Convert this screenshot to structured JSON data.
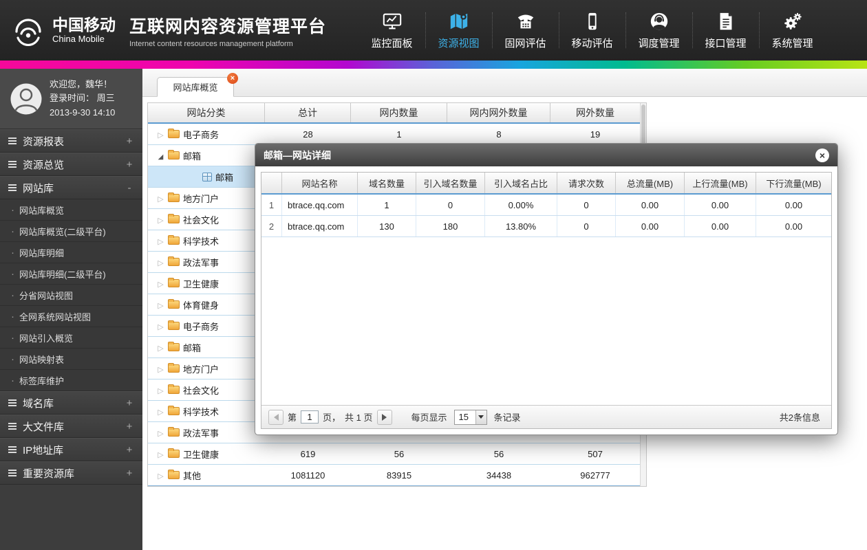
{
  "icons": {
    "close_x": "×"
  },
  "header": {
    "logo_cn": "中国移动",
    "logo_en": "China Mobile",
    "title_cn": "互联网内容资源管理平台",
    "title_en": "Internet content resources management platform",
    "nav": [
      {
        "label": "监控面板"
      },
      {
        "label": "资源视图"
      },
      {
        "label": "固网评估"
      },
      {
        "label": "移动评估"
      },
      {
        "label": "调度管理"
      },
      {
        "label": "接口管理"
      },
      {
        "label": "系统管理"
      }
    ]
  },
  "sidebar": {
    "user": {
      "welcome": "欢迎您，魏华！",
      "login_label": "登录时间： 周三",
      "login_time": "2013-9-30  14:10"
    },
    "items": [
      {
        "type": "top",
        "label": "资源报表",
        "toggle": "+"
      },
      {
        "type": "top",
        "label": "资源总览",
        "toggle": "+"
      },
      {
        "type": "top",
        "label": "网站库",
        "toggle": "-"
      },
      {
        "type": "sub",
        "label": "网站库概览"
      },
      {
        "type": "sub",
        "label": "网站库概览(二级平台)"
      },
      {
        "type": "sub",
        "label": "网站库明细"
      },
      {
        "type": "sub",
        "label": "网站库明细(二级平台)"
      },
      {
        "type": "sub",
        "label": "分省网站视图"
      },
      {
        "type": "sub",
        "label": "全网系统网站视图"
      },
      {
        "type": "sub",
        "label": "网站引入概览"
      },
      {
        "type": "sub",
        "label": "网站映射表"
      },
      {
        "type": "sub",
        "label": "标签库维护"
      },
      {
        "type": "top",
        "label": "域名库",
        "toggle": "+"
      },
      {
        "type": "top",
        "label": "大文件库",
        "toggle": "+"
      },
      {
        "type": "top",
        "label": "IP地址库",
        "toggle": "+"
      },
      {
        "type": "top",
        "label": "重要资源库",
        "toggle": "+"
      }
    ]
  },
  "main": {
    "tab_label": "网站库概览",
    "table": {
      "headers": [
        "网站分类",
        "总计",
        "网内数量",
        "网内网外数量",
        "网外数量"
      ],
      "rows": [
        {
          "level": 1,
          "marker": "collapsed",
          "label": "电子商务",
          "values": [
            "28",
            "1",
            "8",
            "19"
          ]
        },
        {
          "level": 1,
          "marker": "expanded",
          "label": "邮箱",
          "values": [
            "",
            "",
            "",
            ""
          ]
        },
        {
          "level": 2,
          "marker": "none",
          "label": "邮箱",
          "selected": true,
          "values": [
            "",
            "",
            "",
            ""
          ]
        },
        {
          "level": 1,
          "marker": "collapsed",
          "label": "地方门户",
          "values": [
            "",
            "",
            "",
            ""
          ]
        },
        {
          "level": 1,
          "marker": "collapsed",
          "label": "社会文化",
          "values": [
            "",
            "",
            "",
            ""
          ]
        },
        {
          "level": 1,
          "marker": "collapsed",
          "label": "科学技术",
          "values": [
            "",
            "",
            "",
            ""
          ]
        },
        {
          "level": 1,
          "marker": "collapsed",
          "label": "政法军事",
          "values": [
            "",
            "",
            "",
            ""
          ]
        },
        {
          "level": 1,
          "marker": "collapsed",
          "label": "卫生健康",
          "values": [
            "",
            "",
            "",
            ""
          ]
        },
        {
          "level": 1,
          "marker": "collapsed",
          "label": "体育健身",
          "values": [
            "",
            "",
            "",
            ""
          ]
        },
        {
          "level": 1,
          "marker": "collapsed",
          "label": "电子商务",
          "values": [
            "",
            "",
            "",
            ""
          ]
        },
        {
          "level": 1,
          "marker": "collapsed",
          "label": "邮箱",
          "values": [
            "",
            "",
            "",
            ""
          ]
        },
        {
          "level": 1,
          "marker": "collapsed",
          "label": "地方门户",
          "values": [
            "",
            "",
            "",
            ""
          ]
        },
        {
          "level": 1,
          "marker": "collapsed",
          "label": "社会文化",
          "values": [
            "",
            "",
            "",
            ""
          ]
        },
        {
          "level": 1,
          "marker": "collapsed",
          "label": "科学技术",
          "values": [
            "",
            "",
            "",
            ""
          ]
        },
        {
          "level": 1,
          "marker": "collapsed",
          "label": "政法军事",
          "values": [
            "",
            "",
            "",
            ""
          ]
        },
        {
          "level": 1,
          "marker": "collapsed",
          "label": "卫生健康",
          "values": [
            "619",
            "56",
            "56",
            "507"
          ]
        },
        {
          "level": 1,
          "marker": "collapsed",
          "label": "其他",
          "values": [
            "1081120",
            "83915",
            "34438",
            "962777"
          ]
        }
      ]
    }
  },
  "modal": {
    "title": "邮箱—网站详细",
    "table": {
      "headers": [
        "网站名称",
        "域名数量",
        "引入域名数量",
        "引入域名占比",
        "请求次数",
        "总流量(MB)",
        "上行流量(MB)",
        "下行流量(MB)"
      ],
      "rows": [
        {
          "index": "1",
          "cells": [
            "btrace.qq.com",
            "1",
            "0",
            "0.00%",
            "0",
            "0.00",
            "0.00",
            "0.00"
          ]
        },
        {
          "index": "2",
          "cells": [
            "btrace.qq.com",
            "130",
            "180",
            "13.80%",
            "0",
            "0.00",
            "0.00",
            "0.00"
          ]
        }
      ]
    },
    "pagination": {
      "label_page_prefix": "第",
      "page_value": "1",
      "label_page_suffix": "页，",
      "label_total_pages": "共 1 页",
      "label_per_page": "每页显示",
      "per_page_value": "15",
      "label_records": "条记录",
      "total_info": "共2条信息"
    }
  }
}
